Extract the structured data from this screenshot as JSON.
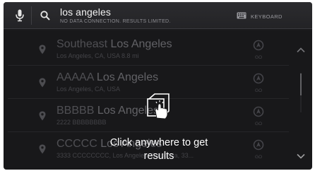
{
  "search": {
    "query": "los angeles",
    "status": "NO DATA CONNECTION. RESULTS LIMITED.",
    "keyboard_label": "KEYBOARD"
  },
  "results": [
    {
      "title_prefix": "Southeast ",
      "title_match": "Los Angeles",
      "subtitle": "Los Angeles, CA, USA 8.8 mi",
      "nav_label": "GO"
    },
    {
      "title_prefix": "AAAAA ",
      "title_match": "Los Angeles",
      "subtitle": "Los Angeles, CA, USA",
      "nav_label": "GO"
    },
    {
      "title_prefix": "BBBBB ",
      "title_match": "Los Angeles",
      "subtitle": "2222 BBBBBBBB",
      "nav_label": "GO"
    },
    {
      "title_prefix": "CCCCC ",
      "title_match": "Los Angeles",
      "subtitle": "3333 CCCCCCCC, Los Angeles, California, 33...",
      "nav_label": "GO"
    }
  ],
  "overlay": {
    "message_line1": "Click anywhere to get",
    "message_line2": "results"
  },
  "scroll": {
    "position": 0.05,
    "visible_fraction": 0.55
  },
  "colors": {
    "background": "#1b1b1d",
    "header": "#2a2a2d",
    "text_primary": "#f2f2f2",
    "text_dim": "#6f6f74"
  }
}
